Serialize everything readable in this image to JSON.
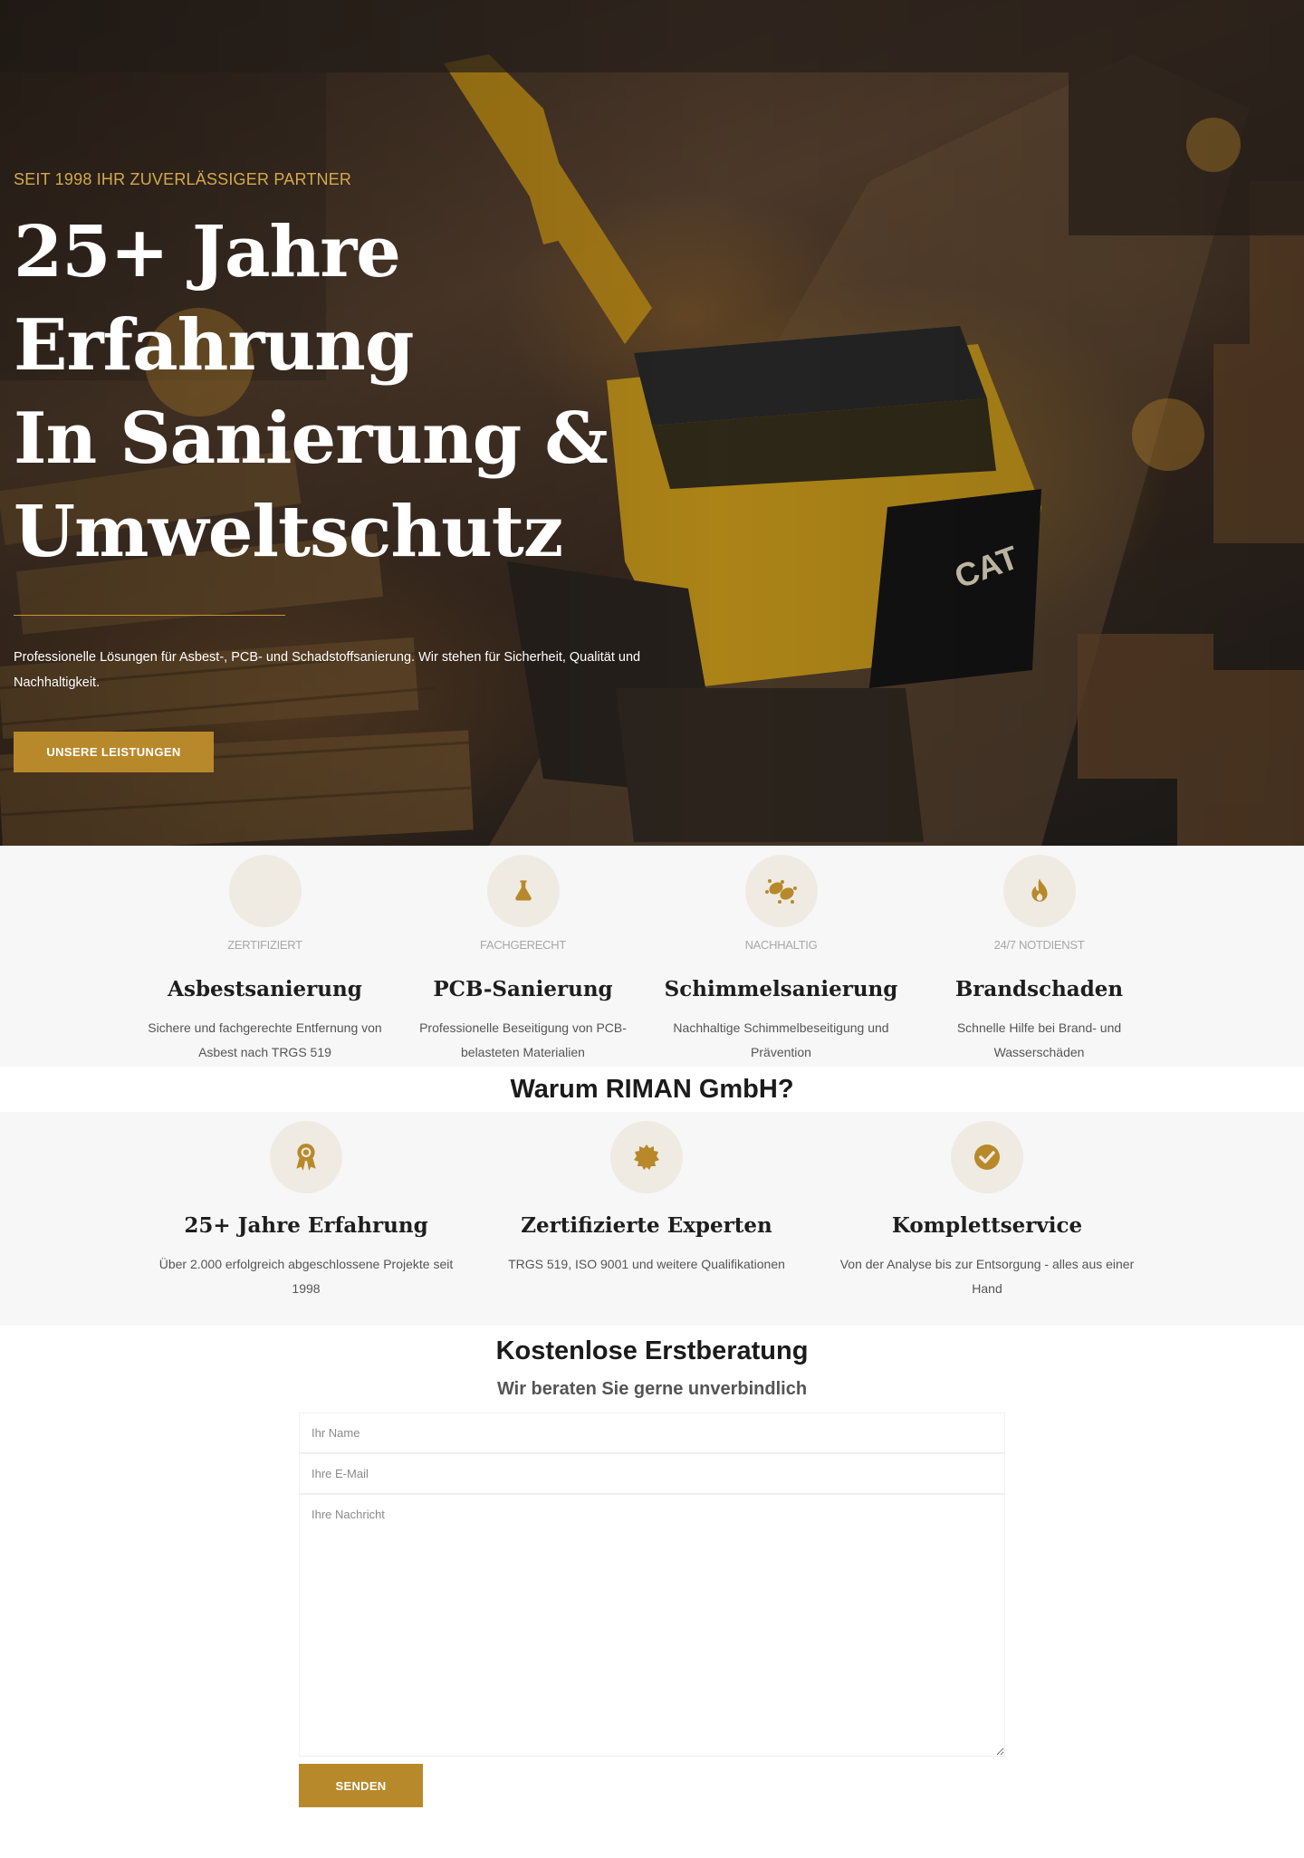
{
  "hero": {
    "eyebrow": "SEIT 1998 IHR ZUVERLÄSSIGER PARTNER",
    "title_line1": "25+ Jahre Erfahrung",
    "title_line2": "In Sanierung &",
    "title_line3": "Umweltschutz",
    "text": "Professionelle Lösungen für Asbest-, PCB- und Schadstoffsanierung. Wir stehen für Sicherheit, Qualität und Nachhaltigkeit.",
    "button_label": "UNSERE LEISTUNGEN"
  },
  "services": [
    {
      "badge": "ZERTIFIZIERT",
      "title": "Asbestsanierung",
      "description": "Sichere und fachgerechte Entfernung von Asbest nach TRGS 519",
      "icon": "blank-icon"
    },
    {
      "badge": "FACHGERECHT",
      "title": "PCB-Sanierung",
      "description": "Professionelle Beseitigung von PCB-belasteten Materialien",
      "icon": "flask-icon"
    },
    {
      "badge": "NACHHALTIG",
      "title": "Schimmelsanierung",
      "description": "Nachhaltige Schimmelbeseitigung und Prävention",
      "icon": "bacteria-icon"
    },
    {
      "badge": "24/7 NOTDIENST",
      "title": "Brandschaden",
      "description": "Schnelle Hilfe bei Brand- und Wasserschäden",
      "icon": "fire-icon"
    }
  ],
  "why": {
    "heading": "Warum RIMAN GmbH?",
    "items": [
      {
        "title": "25+ Jahre Erfahrung",
        "description": "Über 2.000 erfolgreich abgeschlossene Projekte seit 1998",
        "icon": "award-icon"
      },
      {
        "title": "Zertifizierte Experten",
        "description": "TRGS 519, ISO 9001 und weitere Qualifikationen",
        "icon": "certificate-icon"
      },
      {
        "title": "Komplettservice",
        "description": "Von der Analyse bis zur Entsorgung - alles aus einer Hand",
        "icon": "check-circle-icon"
      }
    ]
  },
  "contact": {
    "title": "Kostenlose Erstberatung",
    "subtitle": "Wir beraten Sie gerne unverbindlich",
    "name_placeholder": "Ihr Name",
    "email_placeholder": "Ihre E-Mail",
    "message_placeholder": "Ihre Nachricht",
    "name_value": "",
    "email_value": "",
    "message_value": "",
    "submit_label": "SENDEN"
  },
  "colors": {
    "accent": "#b8892b",
    "eyebrow": "#d4a94a",
    "icon_circle": "#efebe3",
    "section_bg": "#f7f7f7"
  }
}
